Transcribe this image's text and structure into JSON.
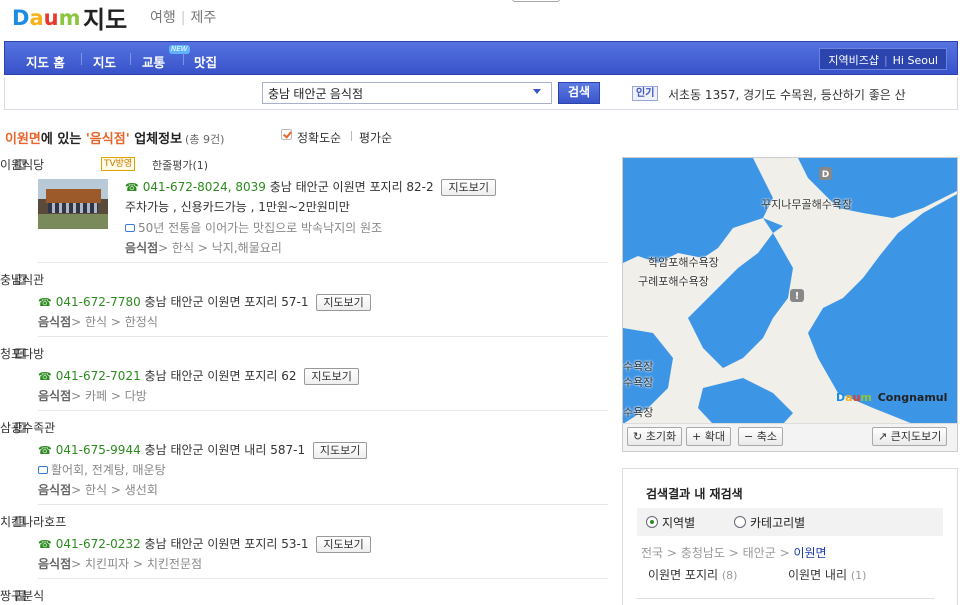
{
  "header": {
    "logo_text": "Daum",
    "title": "지도",
    "links": [
      "여행",
      "제주"
    ]
  },
  "nav": {
    "items": [
      "지도 홈",
      "지도",
      "교통",
      "맛집"
    ],
    "new_badge": "NEW",
    "right_links": [
      "지역비즈샵",
      "Hi Seoul"
    ]
  },
  "search": {
    "value": "충남 태안군 음식점",
    "button": "검색",
    "popular_label": "인기",
    "popular_text": "서초동 1357, 경기도 수목원, 등산하기 좋은 산"
  },
  "results_header": {
    "location": "이원면",
    "middle": "에 있는 ",
    "keyword": "'음식점'",
    "suffix": " 업체정보",
    "count": "(총 9건)",
    "sort_exact": "정확도순",
    "sort_rating": "평가순"
  },
  "results": [
    {
      "badge": "A",
      "name": "이원식당",
      "tv_badge": "TV방영",
      "review": "한줄평가(1)",
      "tel": "041-672-8024, 8039",
      "address": "충남 태안군 이원면 포지리 82-2",
      "map_btn": "지도보기",
      "extra": "주차가능 , 신용카드가능 , 1만원~2만원미만",
      "note": "50년 전통을 이어가는 맛집으로 박속낙지의 원조",
      "cat_label": "음식점",
      "cat_path": "> 한식 > 낙지,해물요리"
    },
    {
      "badge": "B",
      "name": "충남식관",
      "tel": "041-672-7780",
      "address": "충남 태안군 이원면 포지리 57-1",
      "map_btn": "지도보기",
      "cat_label": "음식점",
      "cat_path": "> 한식 > 한정식"
    },
    {
      "badge": "C",
      "name": "청포다방",
      "tel": "041-672-7021",
      "address": "충남 태안군 이원면 포지리 62",
      "map_btn": "지도보기",
      "cat_label": "음식점",
      "cat_path": "> 카페 > 다방"
    },
    {
      "badge": "D",
      "name": "삼광수족관",
      "tel": "041-675-9944",
      "address": "충남 태안군 이원면 내리 587-1",
      "map_btn": "지도보기",
      "note": "활어회, 전계탕, 매운탕",
      "cat_label": "음식점",
      "cat_path": "> 한식 > 생선회"
    },
    {
      "badge": "E",
      "name": "치킨나라호프",
      "tel": "041-672-0232",
      "address": "충남 태안군 이원면 포지리 53-1",
      "map_btn": "지도보기",
      "cat_label": "음식점",
      "cat_path": "> 치킨피자 > 치킨전문점"
    },
    {
      "badge": "F",
      "name": "짱구분식"
    }
  ],
  "map": {
    "labels": [
      "꾸지나무골해수욕장",
      "학암포해수욕장",
      "구례포해수욕장",
      "수욕장",
      "수욕장",
      "수욕장"
    ],
    "pin_d": "D",
    "pin_i": "!",
    "brand": "Daum",
    "provider": "Congnamul",
    "controls": [
      "초기화",
      "확대",
      "축소",
      "큰지도보기"
    ]
  },
  "refine": {
    "title": "검색결과 내 재검색",
    "tab_region": "지역별",
    "tab_category": "카테고리별",
    "crumb": [
      "전국",
      "충청남도",
      "태안군",
      "이원면"
    ],
    "subs": [
      {
        "name": "이원면 포지리",
        "count": "(8)"
      },
      {
        "name": "이원면 내리",
        "count": "(1)"
      }
    ]
  }
}
